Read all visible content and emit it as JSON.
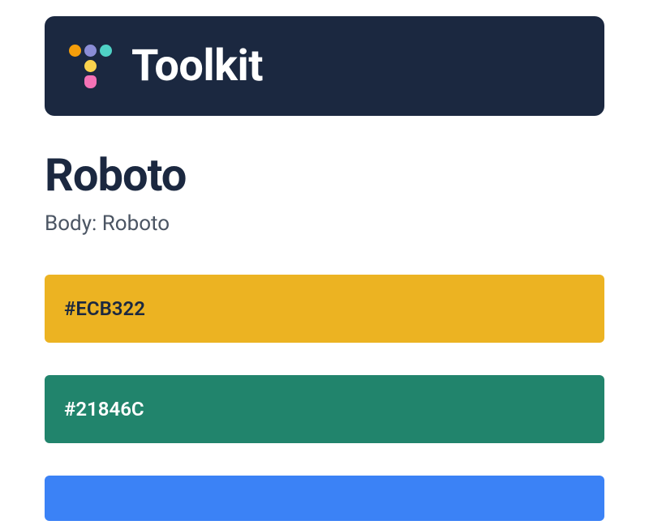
{
  "header": {
    "title": "Toolkit"
  },
  "typography": {
    "font_name": "Roboto",
    "body_label": "Body: Roboto"
  },
  "swatches": [
    {
      "hex": "#ECB322"
    },
    {
      "hex": "#21846C"
    }
  ]
}
